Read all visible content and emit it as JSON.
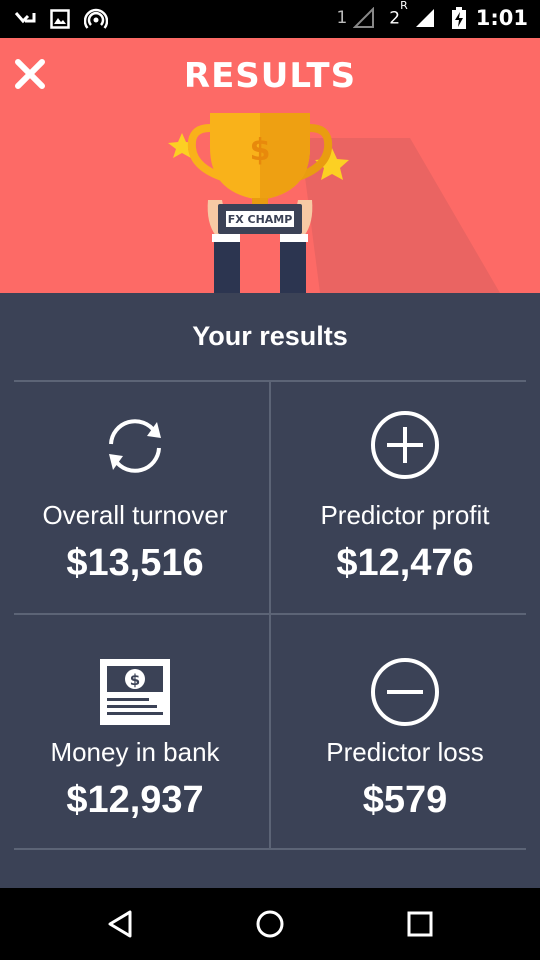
{
  "status_bar": {
    "sim1_label": "1",
    "sim2_label": "2",
    "roaming_label": "R",
    "time": "1:01"
  },
  "header": {
    "title": "RESULTS",
    "trophy_label": "FX CHAMP"
  },
  "results": {
    "section_title": "Your results",
    "items": [
      {
        "label": "Overall turnover",
        "value": "$13,516",
        "icon": "refresh-icon"
      },
      {
        "label": "Predictor profit",
        "value": "$12,476",
        "icon": "plus-circle-icon"
      },
      {
        "label": "Money in bank",
        "value": "$12,937",
        "icon": "banknote-icon"
      },
      {
        "label": "Predictor loss",
        "value": "$579",
        "icon": "minus-circle-icon"
      }
    ]
  },
  "colors": {
    "header_bg": "#fd6a66",
    "main_bg": "#3b4256",
    "divider": "#5c6476",
    "trophy_gold": "#f9b21a"
  }
}
